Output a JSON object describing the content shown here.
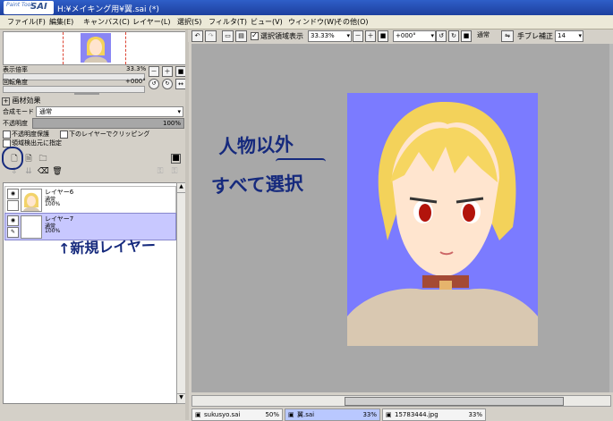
{
  "app": {
    "logo_small": "Paint Tool",
    "logo_big": "SAI",
    "title": "H:¥メイキング用¥翼.sai (*)"
  },
  "menu": [
    "ファイル(F)",
    "編集(E)",
    "キャンバス(C)",
    "レイヤー(L)",
    "選択(S)",
    "フィルタ(T)",
    "ビュー(V)",
    "ウィンドウ(W)",
    "その他(O)"
  ],
  "navigator": {
    "zoom_label": "表示倍率",
    "zoom_value": "33.3%",
    "rotate_label": "回転角度",
    "rotate_value": "+000°"
  },
  "paper_effect": {
    "header": "画材効果",
    "blend_label": "合成モード",
    "blend_value": "通常",
    "opacity_label": "不透明度",
    "opacity_value": "100%",
    "protect_opacity": "不透明度保護",
    "clip_below": "下のレイヤーでクリッピング",
    "sample_source": "領域検出元に指定"
  },
  "layers": [
    {
      "name": "レイヤー6",
      "mode": "通常",
      "opacity": "100%",
      "selected": false
    },
    {
      "name": "レイヤー7",
      "mode": "通常",
      "opacity": "100%",
      "selected": true
    }
  ],
  "toolbar": {
    "selection_visible": "選択領域表示",
    "zoom": "33.33%",
    "rotation": "+000°",
    "blend": "通常",
    "stabilizer_label": "手ブレ補正",
    "stabilizer_value": "14"
  },
  "tabs": [
    {
      "name": "sukusyo.sai",
      "zoom": "50%",
      "active": false
    },
    {
      "name": "翼.sai",
      "zoom": "33%",
      "active": true
    },
    {
      "name": "15783444.jpg",
      "zoom": "33%",
      "active": false
    }
  ],
  "annotations": {
    "outside_person_1": "人物以外",
    "outside_person_2": "すべて選択",
    "new_layer": "↑新規レイヤー"
  },
  "colors": {
    "canvas_bg": "#7b7bff",
    "selected_layer": "#c8c8ff",
    "ink": "#162a7d"
  }
}
